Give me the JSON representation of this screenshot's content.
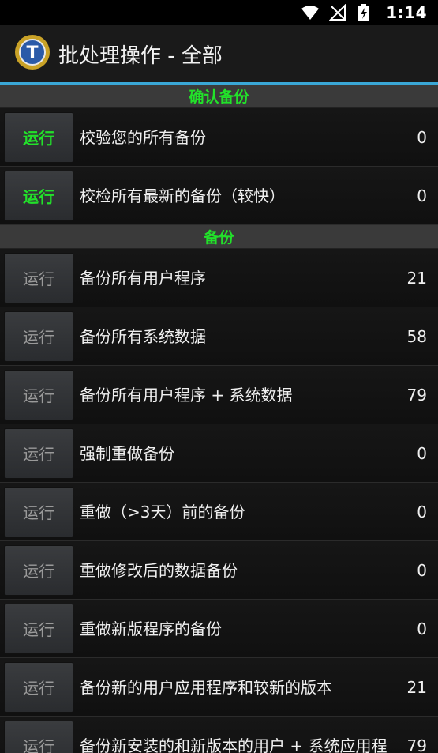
{
  "status_bar": {
    "time": "1:14"
  },
  "app_bar": {
    "title": "批处理操作 - 全部"
  },
  "sections": [
    {
      "header": "确认备份",
      "items": [
        {
          "button": "运行",
          "label": "校验您的所有备份",
          "count": "0"
        },
        {
          "button": "运行",
          "label": "校检所有最新的备份（较快）",
          "count": "0"
        }
      ]
    },
    {
      "header": "备份",
      "items": [
        {
          "button": "运行",
          "label": "备份所有用户程序",
          "count": "21"
        },
        {
          "button": "运行",
          "label": "备份所有系统数据",
          "count": "58"
        },
        {
          "button": "运行",
          "label": "备份所有用户程序 + 系统数据",
          "count": "79"
        },
        {
          "button": "运行",
          "label": "强制重做备份",
          "count": "0"
        },
        {
          "button": "运行",
          "label": "重做（>3天）前的备份",
          "count": "0"
        },
        {
          "button": "运行",
          "label": "重做修改后的数据备份",
          "count": "0"
        },
        {
          "button": "运行",
          "label": "重做新版程序的备份",
          "count": "0"
        },
        {
          "button": "运行",
          "label": "备份新的用户应用程序和较新的版本",
          "count": "21"
        },
        {
          "button": "运行",
          "label": "备份新安装的和新版本的用户 + 系统应用程",
          "count": "79"
        }
      ]
    }
  ],
  "colors": {
    "accent": "#3aa7d6",
    "green": "#22e22a"
  }
}
